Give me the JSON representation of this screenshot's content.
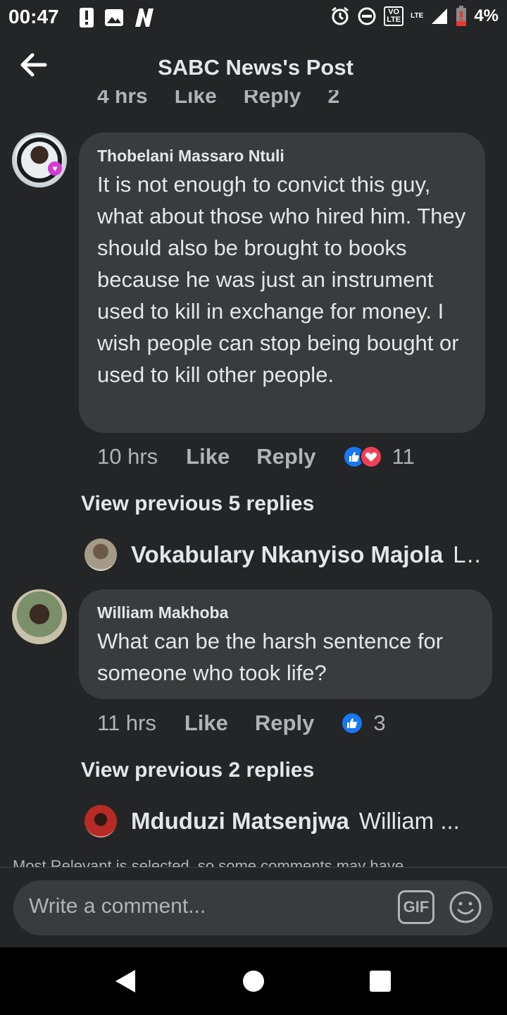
{
  "status_bar": {
    "time": "00:47",
    "battery": "4%",
    "volte_top": "VO",
    "volte_bottom": "LTE",
    "network": "LTE",
    "icons": [
      "alert-icon",
      "image-icon",
      "netflix-icon",
      "alarm-icon",
      "dnd-icon",
      "volte-icon",
      "signal-icon",
      "battery-low-icon"
    ]
  },
  "header": {
    "title": "SABC News's Post"
  },
  "clipped_previous": {
    "time": "4 hrs",
    "like": "Like",
    "reply": "Reply",
    "count": "2"
  },
  "comments": [
    {
      "author": "Thobelani Massaro Ntuli",
      "text": "It is not enough to convict this guy, what about those who hired him. They should also be brought to books because he was just an instrument used to kill in exchange for money. I wish people can stop being bought or used to kill other people.",
      "time": "10 hrs",
      "like": "Like",
      "reply": "Reply",
      "reaction_count": "11",
      "view_previous": "View previous 5 replies",
      "latest_reply": {
        "name": "Vokabulary Nkanyiso Majola",
        "preview": "L..."
      }
    },
    {
      "author": "William Makhoba",
      "text": "What can be the harsh sentence for someone who took life?",
      "time": "11 hrs",
      "like": "Like",
      "reply": "Reply",
      "reaction_count": "3",
      "view_previous": "View previous 2 replies",
      "latest_reply": {
        "name": "Mduduzi Matsenjwa",
        "preview": "William ..."
      }
    }
  ],
  "notice": "Most Relevant is selected, so some comments may have",
  "composer": {
    "placeholder": "Write a comment...",
    "gif_label": "GIF"
  },
  "colors": {
    "background": "#242526",
    "bubble": "#3a3b3c",
    "like_blue": "#1877f2",
    "love_red": "#f33e58"
  }
}
